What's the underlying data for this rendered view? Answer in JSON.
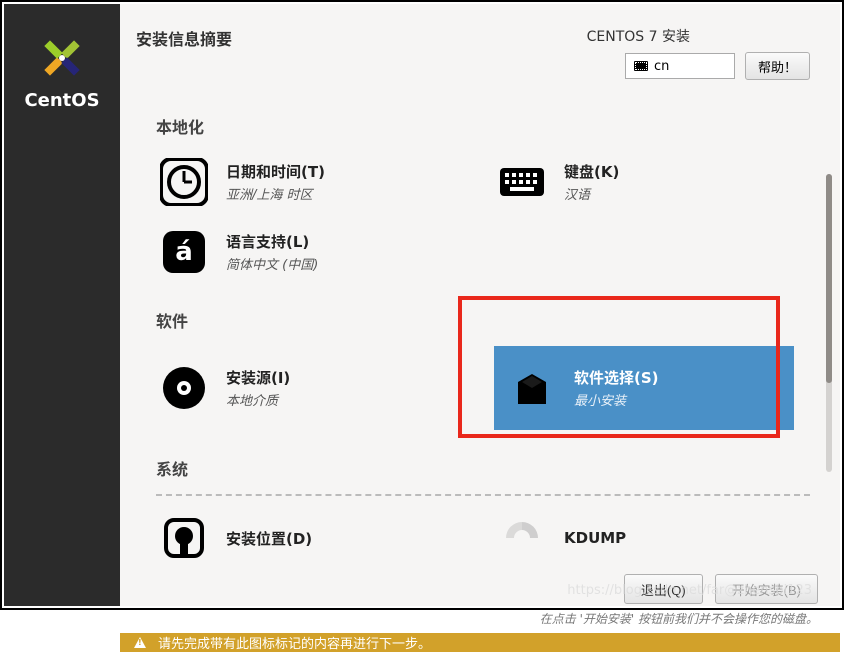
{
  "brand": "CentOS",
  "header": {
    "title": "安装信息摘要",
    "product": "CENTOS 7 安装",
    "lang_input": "cn",
    "help_label": "帮助！"
  },
  "sections": {
    "local": {
      "title": "本地化",
      "datetime": {
        "title": "日期和时间(T)",
        "sub": "亚洲/上海 时区"
      },
      "keyboard": {
        "title": "键盘(K)",
        "sub": "汉语"
      },
      "language": {
        "title": "语言支持(L)",
        "sub": "简体中文 (中国)"
      }
    },
    "software": {
      "title": "软件",
      "source": {
        "title": "安装源(I)",
        "sub": "本地介质"
      },
      "selection": {
        "title": "软件选择(S)",
        "sub": "最小安装"
      }
    },
    "system": {
      "title": "系统",
      "dest": {
        "title": "安装位置(D)",
        "sub": ""
      },
      "kdump": {
        "title": "KDUMP",
        "sub": ""
      }
    }
  },
  "footer": {
    "quit": "退出(Q)",
    "begin": "开始安装(B)",
    "note": "在点击 '开始安装' 按钮前我们并不会操作您的磁盘。"
  },
  "warning": "请先完成带有此图标标记的内容再进行下一步。",
  "watermark": "https://blog.csdn.net/far@zhensbi123"
}
